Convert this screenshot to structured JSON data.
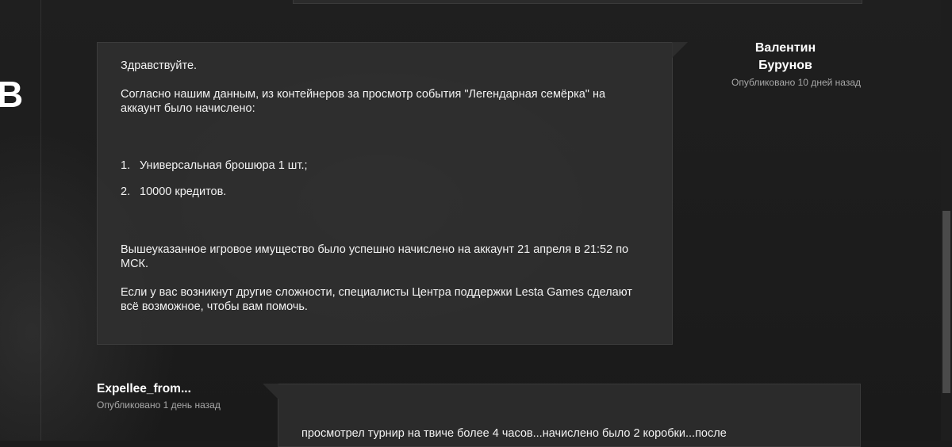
{
  "sidebar": {
    "partial_letter": "В"
  },
  "post": {
    "greeting": "Здравствуйте.",
    "intro": "Согласно нашим данным, из контейнеров за просмотр события \"Легендарная семёрка\" на аккаунт было начислено:",
    "list": [
      {
        "num": "1.",
        "text": "Универсальная брошюра 1 шт.;"
      },
      {
        "num": "2.",
        "text": "10000 кредитов."
      }
    ],
    "credited": "Вышеуказанное игровое имущество было успешно начислено на аккаунт 21 апреля в 21:52 по МСК.",
    "support": "Если у вас возникнут другие сложности, специалисты Центра поддержки Lesta Games сделают всё возможное, чтобы вам помочь.",
    "author": "Валентин Бурунов",
    "published": "Опубликовано 10 дней назад"
  },
  "comment2": {
    "author": "Expellee_from...",
    "published": "Опубликовано 1 день назад",
    "text": "просмотрел турнир на твиче более 4 часов...начислено было 2 коробки...после"
  }
}
